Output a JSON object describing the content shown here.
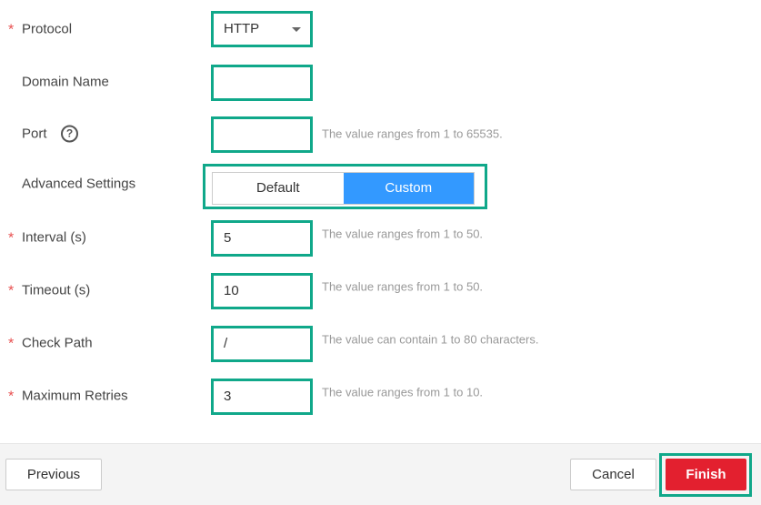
{
  "form": {
    "protocol": {
      "label": "Protocol",
      "required": true,
      "value": "HTTP"
    },
    "domain": {
      "label": "Domain Name",
      "value": ""
    },
    "port": {
      "label": "Port",
      "value": "",
      "hint": "The value ranges from 1 to 65535.",
      "help_icon": "?"
    },
    "advanced": {
      "label": "Advanced Settings",
      "options": [
        "Default",
        "Custom"
      ],
      "selected": "Custom"
    },
    "interval": {
      "label": "Interval (s)",
      "required": true,
      "value": "5",
      "hint": "The value ranges from 1 to 50."
    },
    "timeout": {
      "label": "Timeout (s)",
      "required": true,
      "value": "10",
      "hint": "The value ranges from 1 to 50."
    },
    "path": {
      "label": "Check Path",
      "required": true,
      "value": "/",
      "hint": "The value can contain 1 to 80 characters."
    },
    "retries": {
      "label": "Maximum Retries",
      "required": true,
      "value": "3",
      "hint": "The value ranges from 1 to 10."
    },
    "required_mark": "*"
  },
  "footer": {
    "previous": "Previous",
    "cancel": "Cancel",
    "finish": "Finish"
  },
  "colors": {
    "accent": "#3399ff",
    "finish": "#e3202f",
    "highlight": "#10a88a"
  }
}
